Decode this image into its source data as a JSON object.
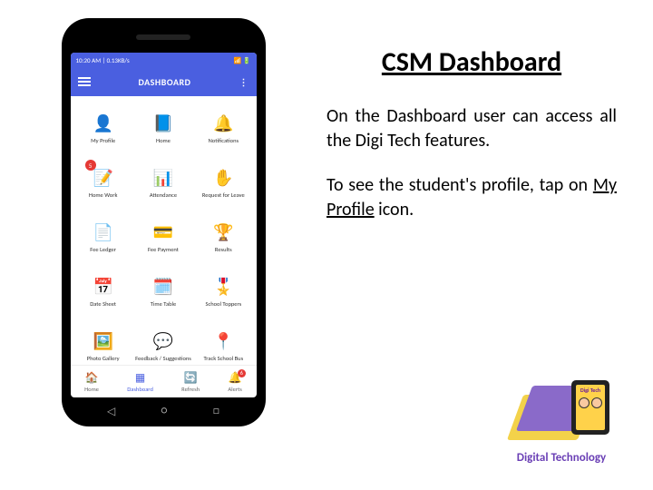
{
  "title": "CSM Dashboard",
  "para1": "On the Dashboard user can access all the Digi Tech features.",
  "para2_pre": "To see the student's profile, tap on ",
  "para2_link": "My Profile",
  "para2_post": " icon.",
  "phone": {
    "status_left": "10:20 AM | 0.13KB/s",
    "status_right": "📶 🔋",
    "appbar_title": "DASHBOARD",
    "tiles": [
      {
        "icon": "👤",
        "label": "My Profile"
      },
      {
        "icon": "📘",
        "label": "Home"
      },
      {
        "icon": "🔔",
        "label": "Notifications"
      },
      {
        "icon": "📝",
        "label": "Home Work",
        "badge": "5"
      },
      {
        "icon": "📊",
        "label": "Attendance"
      },
      {
        "icon": "✋",
        "label": "Request for Leave"
      },
      {
        "icon": "📄",
        "label": "Fee Ledger"
      },
      {
        "icon": "💳",
        "label": "Fee Payment"
      },
      {
        "icon": "🏆",
        "label": "Results"
      },
      {
        "icon": "📅",
        "label": "Date Sheet"
      },
      {
        "icon": "🗓️",
        "label": "Time Table"
      },
      {
        "icon": "🎖️",
        "label": "School Toppers"
      },
      {
        "icon": "🖼️",
        "label": "Photo Gallery"
      },
      {
        "icon": "💬",
        "label": "Feedback / Suggestions"
      },
      {
        "icon": "📍",
        "label": "Track School Bus"
      }
    ],
    "tabs": [
      {
        "icon": "🏠",
        "label": "Home"
      },
      {
        "icon": "▦",
        "label": "Dashboard",
        "active": true
      },
      {
        "icon": "🔄",
        "label": "Refresh"
      },
      {
        "icon": "🔔",
        "label": "Alerts",
        "badge": "6"
      }
    ],
    "nav": {
      "back": "◁",
      "home": "○",
      "recent": "□"
    }
  },
  "logo": {
    "tablet_label": "Digi Tech",
    "caption": "Digital Technology"
  }
}
